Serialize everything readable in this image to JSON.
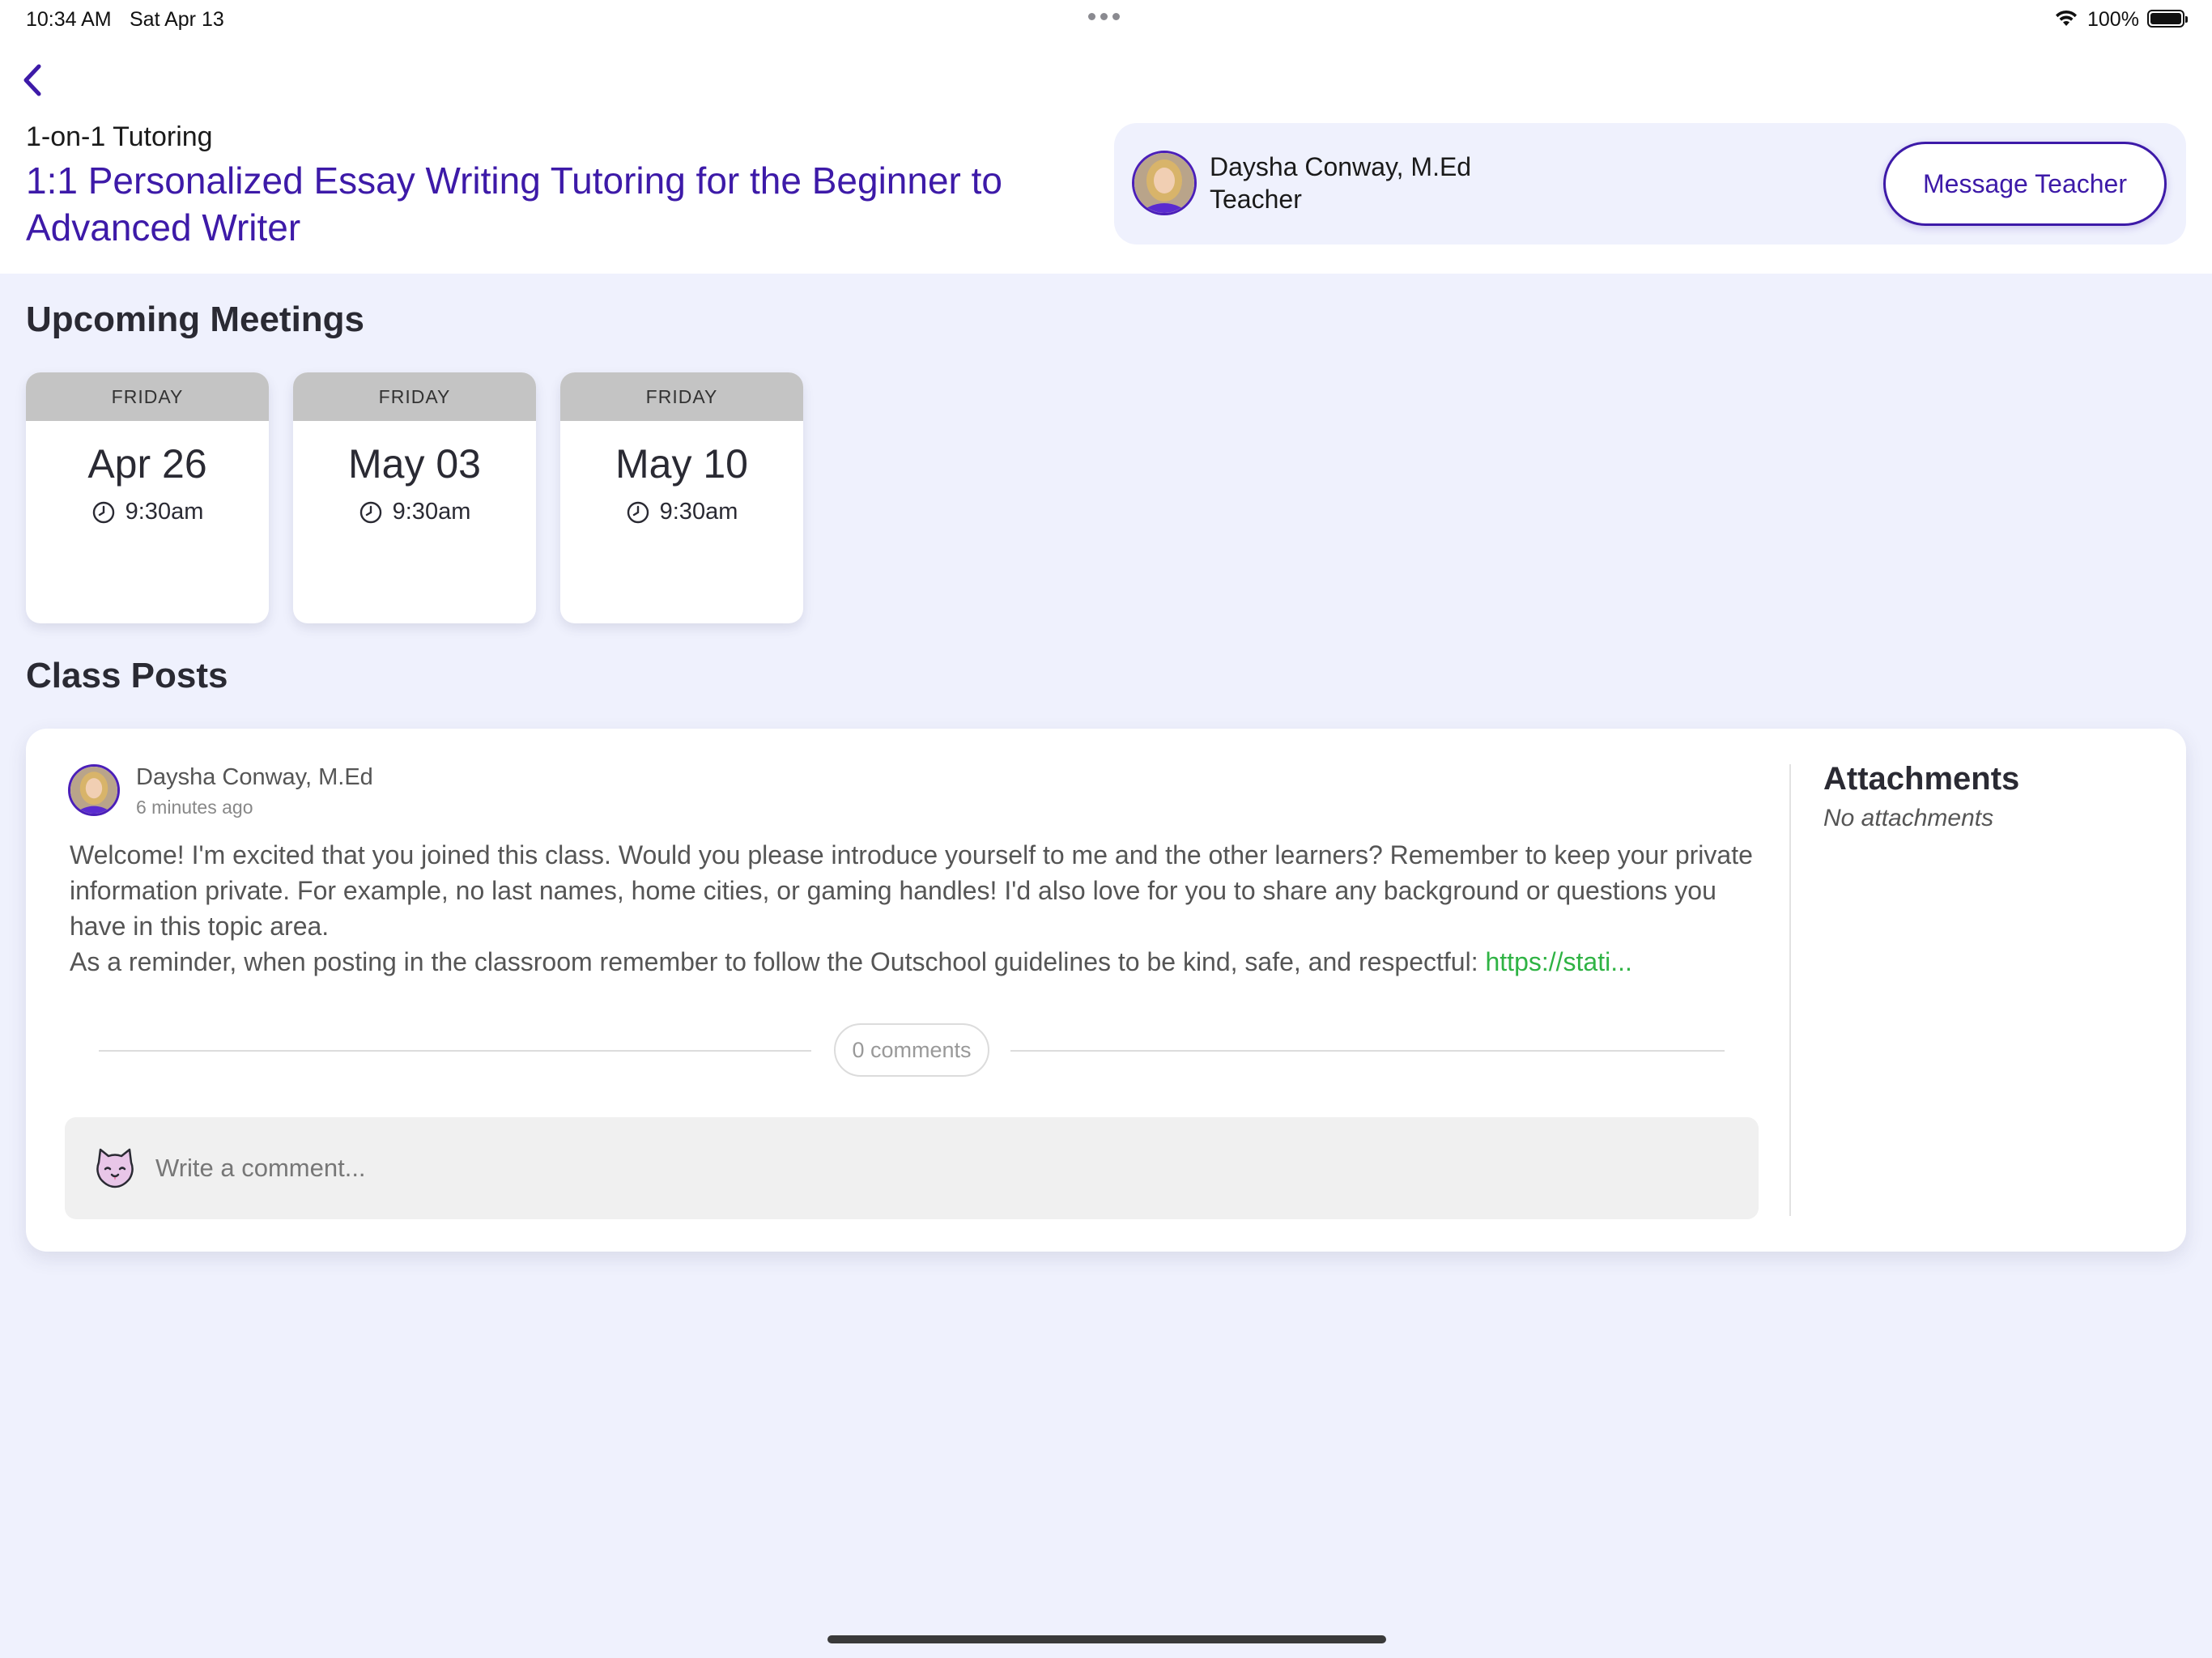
{
  "status_bar": {
    "time": "10:34 AM",
    "date": "Sat Apr 13",
    "battery_percent": "100%",
    "battery_level": 1.0
  },
  "header": {
    "back_icon": "chevron-left-icon",
    "subtitle": "1-on-1 Tutoring",
    "title": "1:1 Personalized Essay Writing Tutoring for the Beginner to Advanced Writer",
    "accent_color": "#3d1aa8"
  },
  "teacher": {
    "name": "Daysha Conway, M.Ed",
    "role": "Teacher",
    "message_button_label": "Message Teacher"
  },
  "upcoming_meetings": {
    "title": "Upcoming Meetings",
    "items": [
      {
        "day": "FRIDAY",
        "date": "Apr 26",
        "time": "9:30am"
      },
      {
        "day": "FRIDAY",
        "date": "May 03",
        "time": "9:30am"
      },
      {
        "day": "FRIDAY",
        "date": "May 10",
        "time": "9:30am"
      }
    ]
  },
  "class_posts": {
    "title": "Class Posts",
    "post": {
      "author": "Daysha Conway, M.Ed",
      "time_ago": "6 minutes ago",
      "paragraph1": "Welcome! I'm excited that you joined this class. Would you please introduce yourself to me and the other learners? Remember to keep your private information private. For example, no last names, home cities, or gaming handles! I'd also love for you to share any background or questions you have in this topic area.",
      "paragraph2": "As a reminder, when posting in the classroom remember to follow the Outschool guidelines to be kind, safe, and respectful: ",
      "link_text": "https://stati...",
      "link_color": "#2fb344",
      "comments_label": "0 comments",
      "comment_placeholder": "Write a comment...",
      "comment_icon": "cat-mascot-icon"
    },
    "attachments": {
      "title": "Attachments",
      "empty_text": "No attachments"
    }
  }
}
